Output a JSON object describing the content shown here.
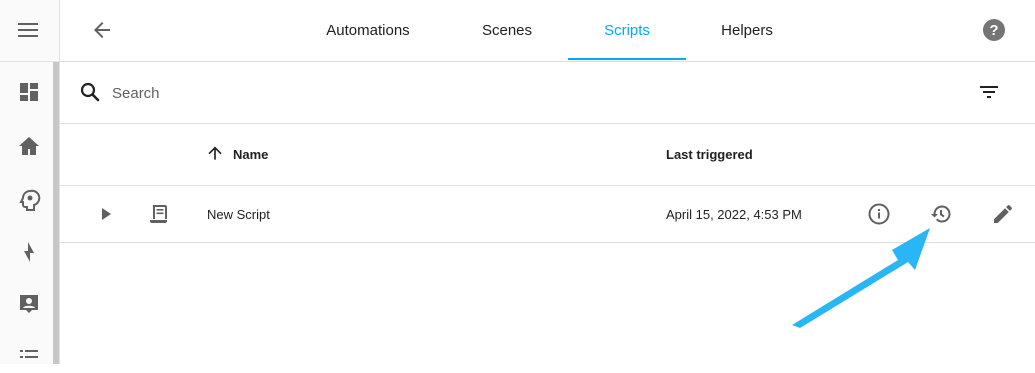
{
  "sidebar": {
    "items": [
      {
        "name": "overview",
        "icon": "view-dashboard-icon"
      },
      {
        "name": "map",
        "icon": "home-icon"
      },
      {
        "name": "settings-brain",
        "icon": "head-gear-icon"
      },
      {
        "name": "energy",
        "icon": "lightning-bolt-icon"
      },
      {
        "name": "logbook",
        "icon": "account-box-icon"
      },
      {
        "name": "history",
        "icon": "format-list-icon"
      }
    ]
  },
  "tabs": [
    {
      "label": "Automations",
      "active": false
    },
    {
      "label": "Scenes",
      "active": false
    },
    {
      "label": "Scripts",
      "active": true
    },
    {
      "label": "Helpers",
      "active": false
    }
  ],
  "search": {
    "placeholder": "Search",
    "value": ""
  },
  "table": {
    "columns": {
      "name": "Name",
      "last_triggered": "Last triggered"
    },
    "rows": [
      {
        "name": "New Script",
        "last_triggered": "April 15, 2022, 4:53 PM"
      }
    ]
  },
  "colors": {
    "accent": "#03a9f4",
    "icon": "#616161",
    "annotation_arrow": "#29b6f6"
  }
}
